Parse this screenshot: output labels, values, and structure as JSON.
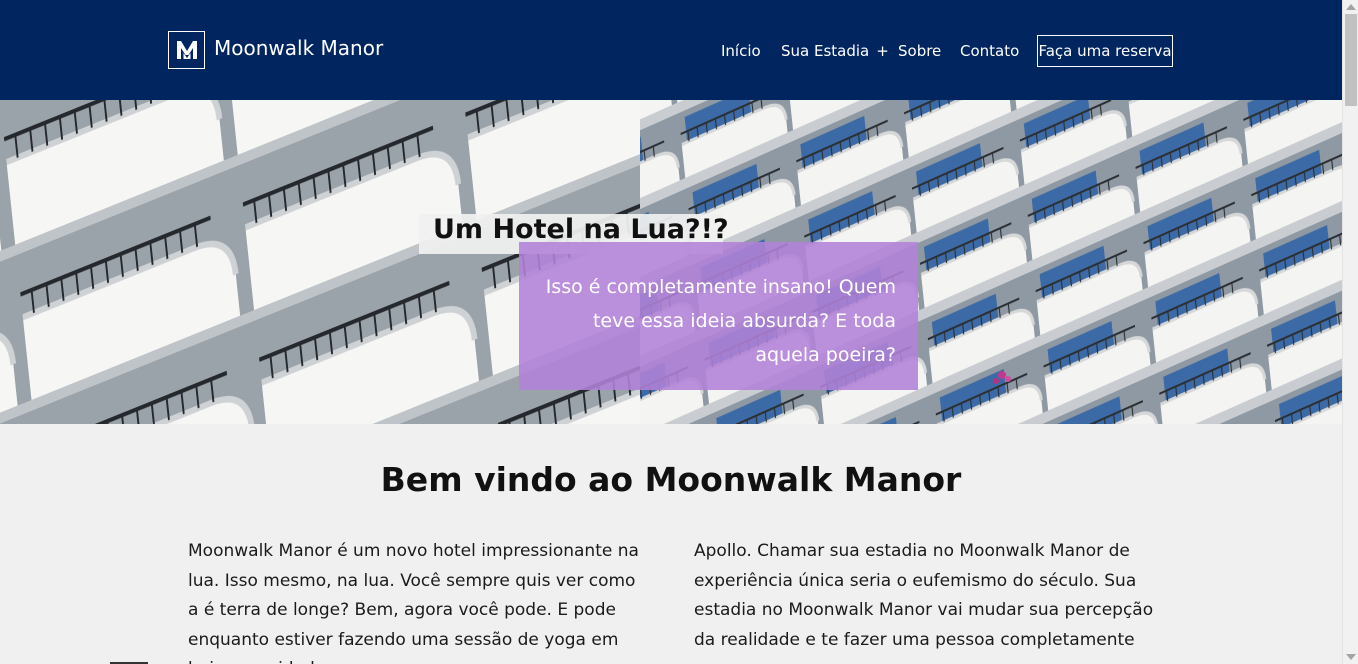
{
  "header": {
    "logo_letter": "M",
    "brand": "Moonwalk Manor",
    "nav": {
      "inicio": "Início",
      "estadia": "Sua Estadia",
      "estadia_icon": "plus-icon",
      "sobre": "Sobre",
      "contato": "Contato"
    },
    "reserve_button": "Faça uma reserva",
    "background_color": "#00255f"
  },
  "hero": {
    "title": "Um Hotel na Lua?!?",
    "text": "Isso é completamente insano! Quem teve essa ideia absurda? E toda aquela poeira?",
    "box_color": "#b282d8",
    "image": "hotel-balconies-image"
  },
  "content": {
    "heading": "Bem vindo ao Moonwalk Manor",
    "left_paragraph": "Moonwalk Manor é um novo hotel impressionante na lua. Isso mesmo, na lua. Você sempre quis ver como a é terra de longe? Bem, agora você pode. E pode enquanto estiver fazendo uma sessão de yoga em baixa gravidade",
    "right_paragraph": "Apollo. Chamar sua estadia no Moonwalk Manor de experiência única seria o eufemismo do século. Sua estadia no Moonwalk Manor vai mudar sua percepção da realidade e te fazer uma pessoa completamente nova."
  }
}
